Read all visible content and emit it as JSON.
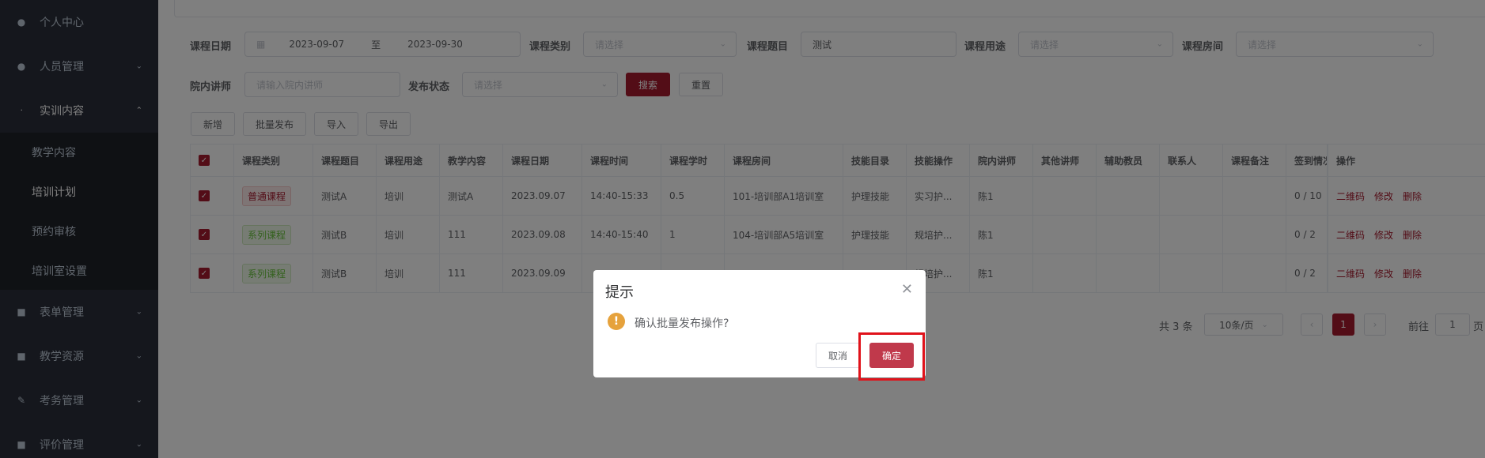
{
  "sidebar": {
    "items": [
      {
        "label": "个人中心",
        "icon": "user-icon"
      },
      {
        "label": "人员管理",
        "icon": "users-icon"
      },
      {
        "label": "实训内容",
        "icon": "tree-icon"
      },
      {
        "label": "表单管理",
        "icon": "form-icon"
      },
      {
        "label": "教学资源",
        "icon": "book-icon"
      },
      {
        "label": "考务管理",
        "icon": "edit-icon"
      },
      {
        "label": "评价管理",
        "icon": "chat-icon"
      }
    ],
    "sub_items": [
      {
        "label": "教学内容"
      },
      {
        "label": "培训计划"
      },
      {
        "label": "预约审核"
      },
      {
        "label": "培训室设置"
      }
    ]
  },
  "filters": {
    "date_label": "课程日期",
    "date_start": "2023-09-07",
    "date_sep": "至",
    "date_end": "2023-09-30",
    "category_label": "课程类别",
    "category_placeholder": "请选择",
    "topic_label": "课程题目",
    "topic_value": "测试",
    "purpose_label": "课程用途",
    "purpose_placeholder": "请选择",
    "room_label": "课程房间",
    "room_placeholder": "请选择",
    "lecturer_label": "院内讲师",
    "lecturer_placeholder": "请输入院内讲师",
    "status_label": "发布状态",
    "status_placeholder": "请选择",
    "search_button": "搜索",
    "reset_button": "重置"
  },
  "toolbar": {
    "add": "新增",
    "batch_publish": "批量发布",
    "import": "导入",
    "export": "导出"
  },
  "table": {
    "headers": [
      "课程类别",
      "课程题目",
      "课程用途",
      "教学内容",
      "课程日期",
      "课程时间",
      "课程学时",
      "课程房间",
      "技能目录",
      "技能操作",
      "院内讲师",
      "其他讲师",
      "辅助教员",
      "联系人",
      "课程备注",
      "签到情况",
      "操作"
    ],
    "rows": [
      {
        "category": "普通课程",
        "topic": "测试A",
        "purpose": "培训",
        "content": "测试A",
        "date": "2023.09.07",
        "time": "14:40-15:33",
        "hours": "0.5",
        "room": "101-培训部A1培训室",
        "skill_dir": "护理技能",
        "skill_op": "实习护...",
        "lecturer": "陈1",
        "checkin": "0 / 10"
      },
      {
        "category": "系列课程",
        "topic": "测试B",
        "purpose": "培训",
        "content": "111",
        "date": "2023.09.08",
        "time": "14:40-15:40",
        "hours": "1",
        "room": "104-培训部A5培训室",
        "skill_dir": "护理技能",
        "skill_op": "规培护...",
        "lecturer": "陈1",
        "checkin": "0 / 2"
      },
      {
        "category": "系列课程",
        "topic": "测试B",
        "purpose": "培训",
        "content": "111",
        "date": "2023.09.09",
        "time": "",
        "hours": "",
        "room": "",
        "skill_dir": "",
        "skill_op": "规培护...",
        "lecturer": "陈1",
        "checkin": "0 / 2"
      }
    ],
    "ops": {
      "qr": "二维码",
      "edit": "修改",
      "delete": "删除"
    }
  },
  "pagination": {
    "total": "共 3 条",
    "page_size": "10条/页",
    "current_page": "1",
    "goto_label": "前往",
    "goto_value": "1",
    "page_suffix": "页"
  },
  "dialog": {
    "title": "提示",
    "message": "确认批量发布操作?",
    "cancel": "取消",
    "confirm": "确定"
  },
  "colors": {
    "accent": "#a61a2e",
    "highlight": "#e0121a"
  }
}
